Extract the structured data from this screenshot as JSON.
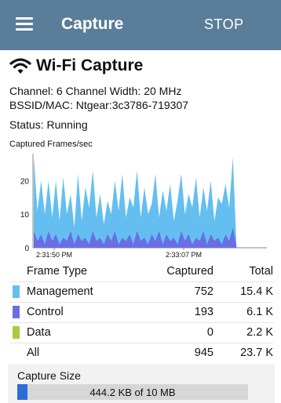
{
  "appbar": {
    "title": "Capture",
    "action_label": "STOP",
    "menu_icon": "hamburger-menu-icon",
    "bg_color": "#5a7d9a"
  },
  "heading": {
    "icon": "wifi-icon",
    "title": "Wi-Fi Capture"
  },
  "details": {
    "channel_line": "Channel:  6   Channel Width:  20 MHz",
    "bssid_line": "BSSID/MAC:  Ntgear:3c3786-719307",
    "status_line": "Status:  Running"
  },
  "chart_data": {
    "type": "area",
    "title": "Captured Frames/sec",
    "xlabel": "",
    "ylabel": "",
    "ylim": [
      0,
      28
    ],
    "yticks": [
      0,
      10,
      20
    ],
    "xtick_labels": [
      "2:31:50 PM",
      "2:33:07 PM"
    ],
    "colors": {
      "Management": "#64bff0",
      "Control": "#6a6ee4",
      "Data": "#a6cc3c"
    },
    "series": [
      {
        "name": "Management",
        "values": [
          27,
          11,
          20,
          10,
          20,
          9,
          20,
          8,
          21,
          10,
          16,
          6,
          22,
          8,
          18,
          12,
          23,
          9,
          16,
          7,
          14,
          10,
          20,
          11,
          22,
          9,
          15,
          12,
          23,
          9,
          18,
          10,
          13,
          22,
          9,
          17,
          11,
          19,
          8,
          14,
          22,
          10,
          16,
          12,
          21,
          9,
          18,
          11,
          20,
          8,
          15,
          13,
          19,
          12,
          27,
          0,
          0,
          0,
          0,
          0,
          0,
          0,
          0,
          0
        ]
      },
      {
        "name": "Control",
        "values": [
          5,
          2,
          4,
          1,
          5,
          2,
          4,
          1,
          3,
          2,
          5,
          1,
          4,
          2,
          3,
          1,
          5,
          2,
          3,
          1,
          4,
          2,
          5,
          1,
          3,
          2,
          4,
          1,
          5,
          2,
          3,
          1,
          4,
          2,
          5,
          1,
          4,
          2,
          3,
          1,
          5,
          2,
          4,
          1,
          3,
          2,
          5,
          1,
          4,
          2,
          3,
          1,
          4,
          2,
          6,
          0,
          0,
          0,
          0,
          0,
          0,
          0,
          0,
          0
        ]
      }
    ]
  },
  "table": {
    "columns": [
      "Frame Type",
      "Captured",
      "Total"
    ],
    "rows": [
      {
        "name": "Management",
        "captured": "752",
        "total": "15.4 K",
        "color": "#64bff0"
      },
      {
        "name": "Control",
        "captured": "193",
        "total": "6.1 K",
        "color": "#6a6ee4"
      },
      {
        "name": "Data",
        "captured": "0",
        "total": "2.2 K",
        "color": "#a6cc3c"
      },
      {
        "name": "All",
        "captured": "945",
        "total": "23.7 K",
        "color": ""
      }
    ]
  },
  "capture_size": {
    "title": "Capture Size",
    "text": "444.2 KB of 10 MB",
    "fraction": 0.0444,
    "color": "#2e6cd8"
  }
}
